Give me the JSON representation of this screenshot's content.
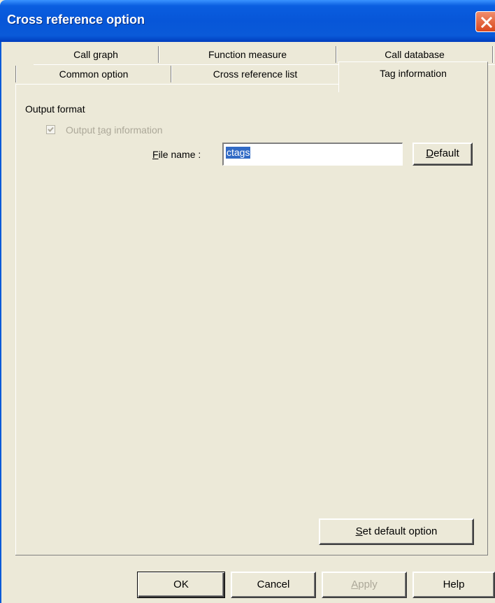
{
  "window": {
    "title": "Cross reference option",
    "close_label": "×"
  },
  "tabs": {
    "row1": [
      {
        "label": "Call graph"
      },
      {
        "label": "Function measure"
      },
      {
        "label": "Call database"
      }
    ],
    "row2": [
      {
        "label": "Common option"
      },
      {
        "label": "Cross reference list"
      },
      {
        "label": "Tag information",
        "active": true
      }
    ]
  },
  "panel": {
    "section_label": "Output format",
    "checkbox": {
      "label_pre": "Output ",
      "label_accel": "t",
      "label_post": "ag information",
      "checked": true,
      "disabled": true
    },
    "file_name": {
      "label_accel": "F",
      "label_rest": "ile name :",
      "value": "ctags"
    },
    "default_button": {
      "accel": "D",
      "rest": "efault"
    },
    "set_default_button": {
      "accel": "S",
      "rest": "et default option"
    }
  },
  "footer": {
    "ok": "OK",
    "cancel": "Cancel",
    "apply_accel": "A",
    "apply_rest": "pply",
    "help": "Help"
  },
  "colors": {
    "title_bar": "#0756d8",
    "dialog_bg": "#ece9d8",
    "selection": "#316ac5",
    "close_button": "#d9481f"
  }
}
